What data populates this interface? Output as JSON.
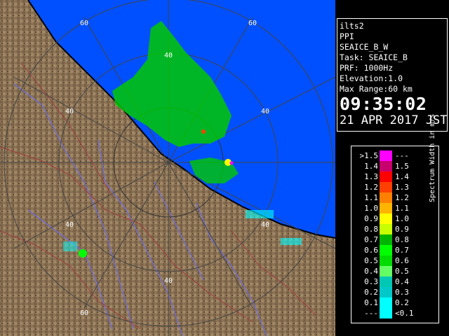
{
  "radar": {
    "range_labels": [
      "40",
      "60",
      "40",
      "40",
      "40",
      "60",
      "40",
      "40",
      "60"
    ]
  },
  "info": {
    "site": "ilts2",
    "mode": "PPI",
    "product": "SEAICE_B_W",
    "task": "Task: SEAICE_B",
    "prf": "PRF: 1000Hz",
    "elevation": "Elevation:1.0",
    "max_range": "Max Range:60 km",
    "time": "09:35:02",
    "date": "21 APR 2017 JST"
  },
  "legend": {
    "unit": "Spectrum Width in m/s",
    "rows": [
      {
        "lo": ">1.5",
        "hi": "---",
        "color": "#ff00ff"
      },
      {
        "lo": "1.4",
        "hi": "1.5",
        "color": "#c8006e"
      },
      {
        "lo": "1.3",
        "hi": "1.4",
        "color": "#ff0000"
      },
      {
        "lo": "1.2",
        "hi": "1.3",
        "color": "#ff4000"
      },
      {
        "lo": "1.1",
        "hi": "1.2",
        "color": "#ff8000"
      },
      {
        "lo": "1.0",
        "hi": "1.1",
        "color": "#ffb400"
      },
      {
        "lo": "0.9",
        "hi": "1.0",
        "color": "#ffff00"
      },
      {
        "lo": "0.8",
        "hi": "0.9",
        "color": "#c8ff00"
      },
      {
        "lo": "0.7",
        "hi": "0.8",
        "color": "#00b400"
      },
      {
        "lo": "0.6",
        "hi": "0.7",
        "color": "#00ff00"
      },
      {
        "lo": "0.5",
        "hi": "0.6",
        "color": "#00dc00"
      },
      {
        "lo": "0.4",
        "hi": "0.5",
        "color": "#64ff64"
      },
      {
        "lo": "0.3",
        "hi": "0.4",
        "color": "#00c8b4"
      },
      {
        "lo": "0.2",
        "hi": "0.3",
        "color": "#00c8c8"
      },
      {
        "lo": "0.1",
        "hi": "0.2",
        "color": "#00ffff"
      },
      {
        "lo": "---",
        "hi": "<0.1",
        "color": "#00ffff"
      }
    ]
  },
  "colors": {
    "sea": "#0050ff",
    "land": "#8c7355",
    "river": "#6e6ee6",
    "border": "#a03c3c"
  }
}
